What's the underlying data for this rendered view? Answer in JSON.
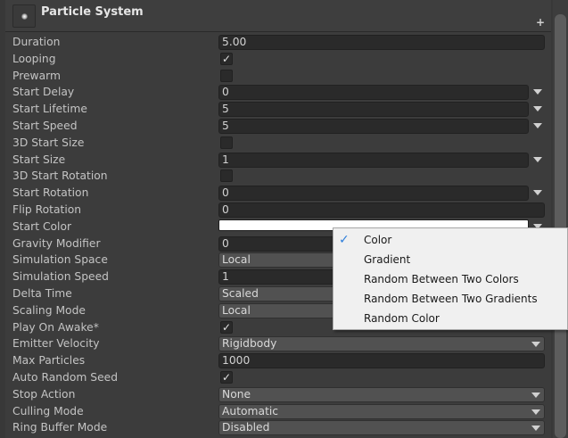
{
  "header": {
    "title": "Particle System",
    "plus_icon": "+"
  },
  "rows": [
    {
      "label": "Duration",
      "kind": "field-full",
      "value": "5.00"
    },
    {
      "label": "Looping",
      "kind": "check",
      "value": "✓"
    },
    {
      "label": "Prewarm",
      "kind": "check",
      "value": ""
    },
    {
      "label": "Start Delay",
      "kind": "field-caret",
      "value": "0"
    },
    {
      "label": "Start Lifetime",
      "kind": "field-caret",
      "value": "5"
    },
    {
      "label": "Start Speed",
      "kind": "field-caret",
      "value": "5"
    },
    {
      "label": "3D Start Size",
      "kind": "check",
      "value": ""
    },
    {
      "label": "Start Size",
      "kind": "field-caret",
      "value": "1"
    },
    {
      "label": "3D Start Rotation",
      "kind": "check",
      "value": ""
    },
    {
      "label": "Start Rotation",
      "kind": "field-caret",
      "value": "0"
    },
    {
      "label": "Flip Rotation",
      "kind": "field-full",
      "value": "0"
    },
    {
      "label": "Start Color",
      "kind": "color",
      "value": "#ffffff"
    },
    {
      "label": "Gravity Modifier",
      "kind": "field-full",
      "value": "0"
    },
    {
      "label": "Simulation Space",
      "kind": "popup",
      "value": "Local"
    },
    {
      "label": "Simulation Speed",
      "kind": "field-full",
      "value": "1"
    },
    {
      "label": "Delta Time",
      "kind": "popup",
      "value": "Scaled"
    },
    {
      "label": "Scaling Mode",
      "kind": "popup",
      "value": "Local"
    },
    {
      "label": "Play On Awake*",
      "kind": "check",
      "value": "✓"
    },
    {
      "label": "Emitter Velocity",
      "kind": "popup",
      "value": "Rigidbody"
    },
    {
      "label": "Max Particles",
      "kind": "field-full",
      "value": "1000"
    },
    {
      "label": "Auto Random Seed",
      "kind": "check",
      "value": "✓"
    },
    {
      "label": "Stop Action",
      "kind": "popup",
      "value": "None"
    },
    {
      "label": "Culling Mode",
      "kind": "popup",
      "value": "Automatic"
    },
    {
      "label": "Ring Buffer Mode",
      "kind": "popup",
      "value": "Disabled"
    }
  ],
  "dropdown_menu": {
    "items": [
      {
        "label": "Color",
        "checked": true
      },
      {
        "label": "Gradient",
        "checked": false
      },
      {
        "label": "Random Between Two Colors",
        "checked": false
      },
      {
        "label": "Random Between Two Gradients",
        "checked": false
      },
      {
        "label": "Random Color",
        "checked": false
      }
    ],
    "check_glyph": "✓"
  },
  "colors": {
    "panel": "#3c3c3c",
    "menu_bg": "#f0f0f0",
    "check_accent": "#2f7fdb"
  }
}
